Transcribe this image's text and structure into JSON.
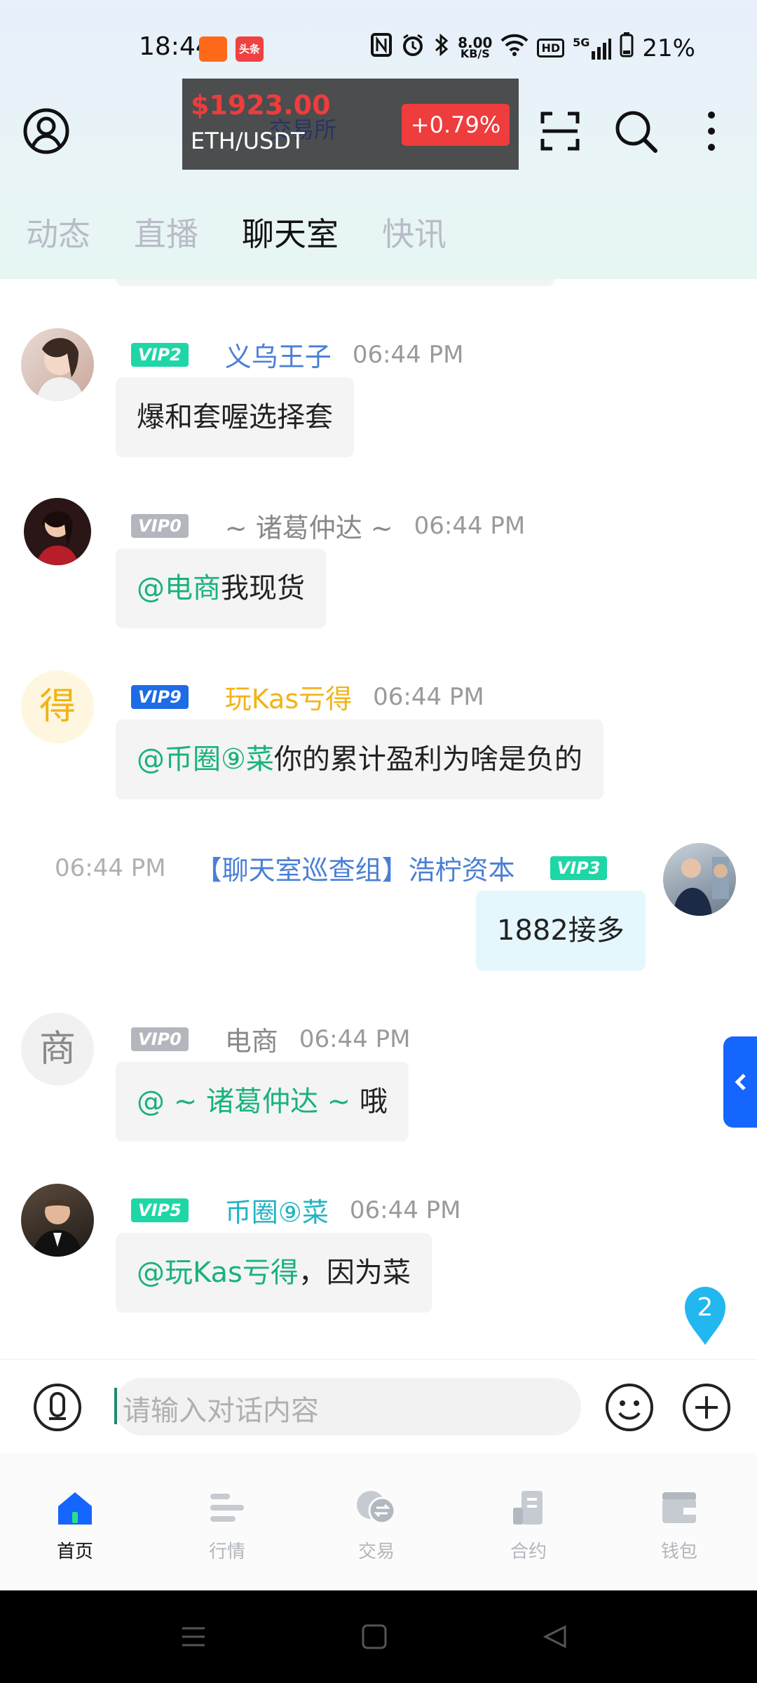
{
  "status_bar": {
    "time": "18:44",
    "news_badge": "头条",
    "net_speed_value": "8.00",
    "net_speed_unit": "KB/S",
    "hd": "HD",
    "net_type": "5G",
    "battery": "21%"
  },
  "ticker": {
    "price": "$1923.00",
    "pair": "ETH/USDT",
    "change": "+0.79%",
    "behind_title": "交易所"
  },
  "tabs": [
    "动态",
    "直播",
    "聊天室",
    "快讯"
  ],
  "active_tab": "聊天室",
  "messages": [
    {
      "vip": "VIP2",
      "name": "义乌王子",
      "time": "06:44 PM",
      "mention": "",
      "text": "爆和套喔选择套"
    },
    {
      "vip": "VIP0",
      "name": "~ 诸葛仲达 ~",
      "time": "06:44 PM",
      "mention": "@电商",
      "text": "我现货"
    },
    {
      "vip": "VIP9",
      "name": "玩Kas亏得",
      "avatar_char": "得",
      "time": "06:44 PM",
      "mention": "@币圈⑨菜",
      "text": "你的累计盈利为啥是负的"
    },
    {
      "vip": "VIP3",
      "name": "【聊天室巡查组】浩柠资本",
      "time": "06:44 PM",
      "mention": "",
      "text": "1882接多"
    },
    {
      "vip": "VIP0",
      "name": "电商",
      "avatar_char": "商",
      "time": "06:44 PM",
      "mention": "@ ~ 诸葛仲达 ~",
      "text": " 哦"
    },
    {
      "vip": "VIP5",
      "name": "币圈⑨菜",
      "time": "06:44 PM",
      "mention": "@玩Kas亏得",
      "text": "，因为菜"
    }
  ],
  "unread_count": "2",
  "input": {
    "placeholder": "请输入对话内容"
  },
  "nav": [
    "首页",
    "行情",
    "交易",
    "合约",
    "钱包"
  ],
  "colors": {
    "accent_green": "#19b27b",
    "vip_green": "#1ed6a6",
    "vip_gray": "#b3b6bd",
    "vip_blue": "#1e6be6",
    "name_blue": "#4a7fd6",
    "name_gold": "#f2b316",
    "name_teal": "#22b3c3",
    "brand_blue": "#1565ff",
    "price_red": "#ef3c3c"
  }
}
